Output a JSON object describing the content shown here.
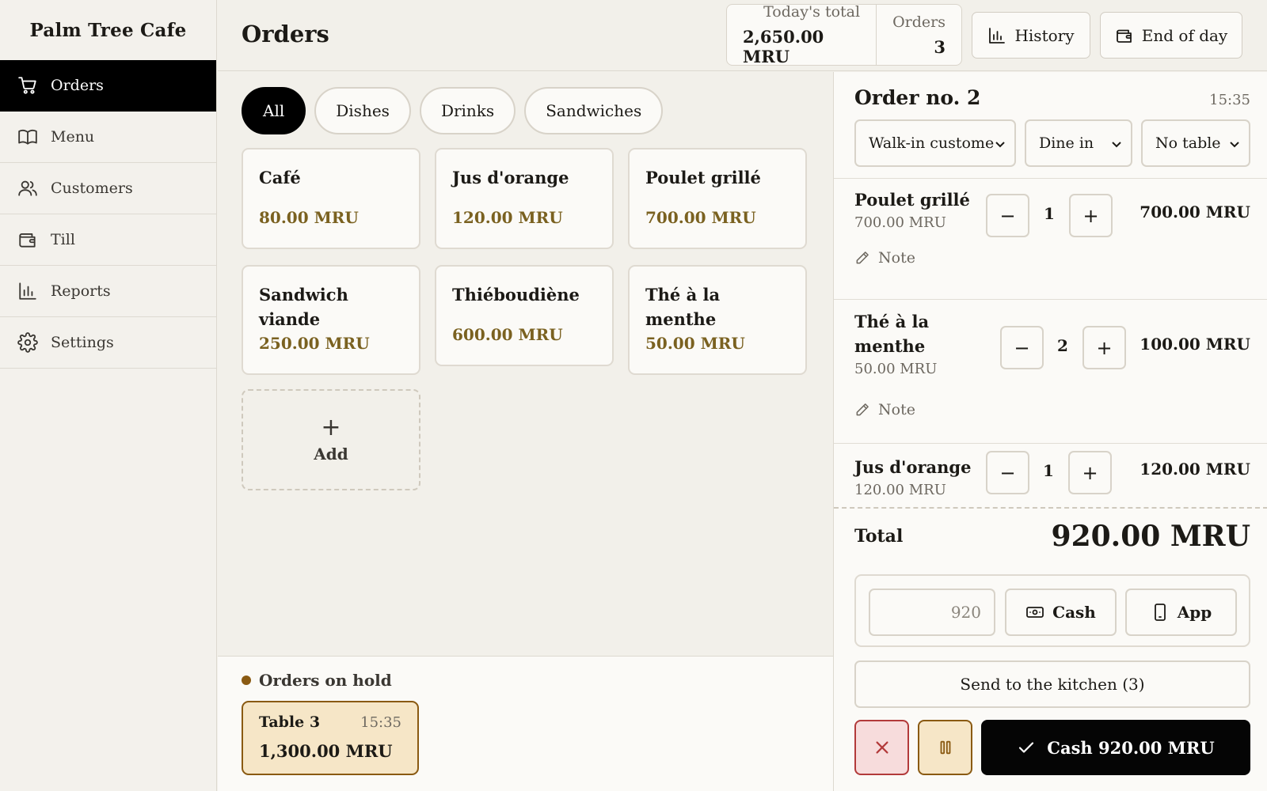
{
  "app": {
    "name": "Palm Tree Cafe"
  },
  "sidebar": {
    "items": [
      {
        "label": "Orders",
        "icon": "cart-icon",
        "active": true
      },
      {
        "label": "Menu",
        "icon": "book-icon"
      },
      {
        "label": "Customers",
        "icon": "users-icon"
      },
      {
        "label": "Till",
        "icon": "wallet-icon"
      },
      {
        "label": "Reports",
        "icon": "bar-chart-icon"
      },
      {
        "label": "Settings",
        "icon": "gear-icon"
      }
    ]
  },
  "header": {
    "title": "Orders",
    "todays_total_label": "Today's total",
    "todays_total_value": "2,650.00 MRU",
    "orders_label": "Orders",
    "orders_value": "3",
    "history_label": "History",
    "end_of_day_label": "End of day"
  },
  "categories": [
    {
      "label": "All",
      "active": true
    },
    {
      "label": "Dishes"
    },
    {
      "label": "Drinks"
    },
    {
      "label": "Sandwiches"
    }
  ],
  "products": [
    {
      "name": "Café",
      "price": "80.00 MRU"
    },
    {
      "name": "Jus d'orange",
      "price": "120.00 MRU"
    },
    {
      "name": "Poulet grillé",
      "price": "700.00 MRU"
    },
    {
      "name": "Sandwich viande",
      "price": "250.00 MRU"
    },
    {
      "name": "Thiéboudiène",
      "price": "600.00 MRU"
    },
    {
      "name": "Thé à la menthe",
      "price": "50.00 MRU"
    }
  ],
  "add_product": {
    "symbol": "+",
    "label": "Add"
  },
  "on_hold": {
    "title": "Orders on hold",
    "orders": [
      {
        "name": "Table 3",
        "time": "15:35",
        "amount": "1,300.00 MRU"
      }
    ]
  },
  "order": {
    "title": "Order no. 2",
    "time": "15:35",
    "customer_select": "Walk-in customer",
    "service_select": "Dine in",
    "table_select": "No table",
    "items": [
      {
        "name": "Poulet grillé",
        "unit_price": "700.00 MRU",
        "qty": "1",
        "total": "700.00 MRU",
        "note": "Note"
      },
      {
        "name": "Thé à la menthe",
        "unit_price": "50.00 MRU",
        "qty": "2",
        "total": "100.00 MRU",
        "note": "Note"
      },
      {
        "name": "Jus d'orange",
        "unit_price": "120.00 MRU",
        "qty": "1",
        "total": "120.00 MRU"
      }
    ],
    "minus_symbol": "−",
    "plus_symbol": "+",
    "total_label": "Total",
    "total_value": "920.00 MRU",
    "amount_placeholder": "920",
    "cash_label": "Cash",
    "app_label": "App",
    "kitchen_label": "Send to the kitchen (3)",
    "pay_label": "Cash 920.00 MRU"
  },
  "colors": {
    "accent": "#000000",
    "price": "#7a6120",
    "hold": "#8a5a12",
    "hold_bg": "#f6e6c7",
    "danger": "#b23a3a",
    "danger_bg": "#f7dcdc"
  }
}
